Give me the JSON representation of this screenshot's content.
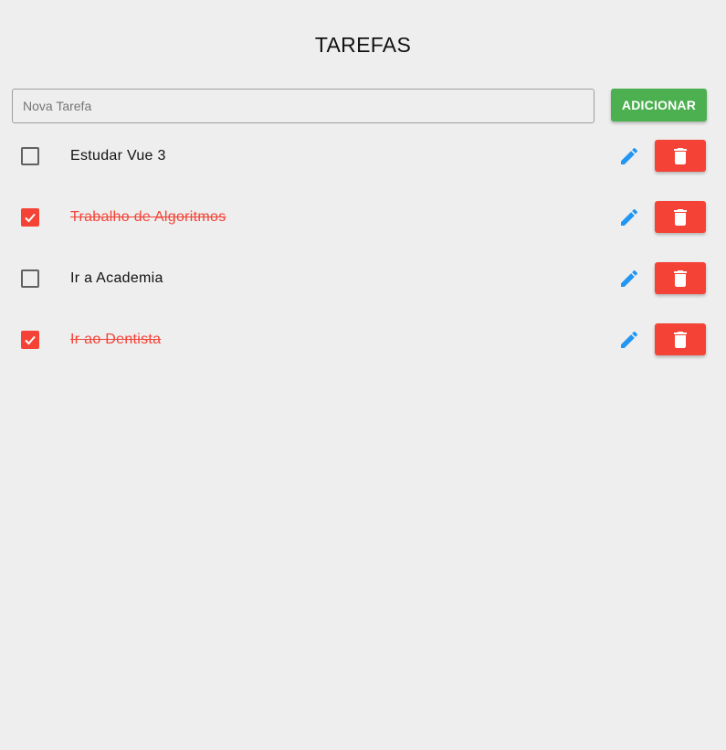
{
  "header": {
    "title": "TAREFAS"
  },
  "new_task": {
    "placeholder": "Nova Tarefa",
    "value": "",
    "add_label": "ADICIONAR"
  },
  "tasks": [
    {
      "text": "Estudar Vue 3",
      "done": false
    },
    {
      "text": "Trabalho de Algoritmos",
      "done": true
    },
    {
      "text": "Ir a Academia",
      "done": false
    },
    {
      "text": "Ir ao Dentista",
      "done": true
    }
  ],
  "icons": {
    "edit": "pencil-icon",
    "delete": "trash-icon",
    "check": "check-icon"
  },
  "colors": {
    "background": "#eeeeee",
    "add_button": "#4caf50",
    "delete_button": "#f44336",
    "done_text": "#f44336",
    "edit_icon": "#2196f3"
  }
}
